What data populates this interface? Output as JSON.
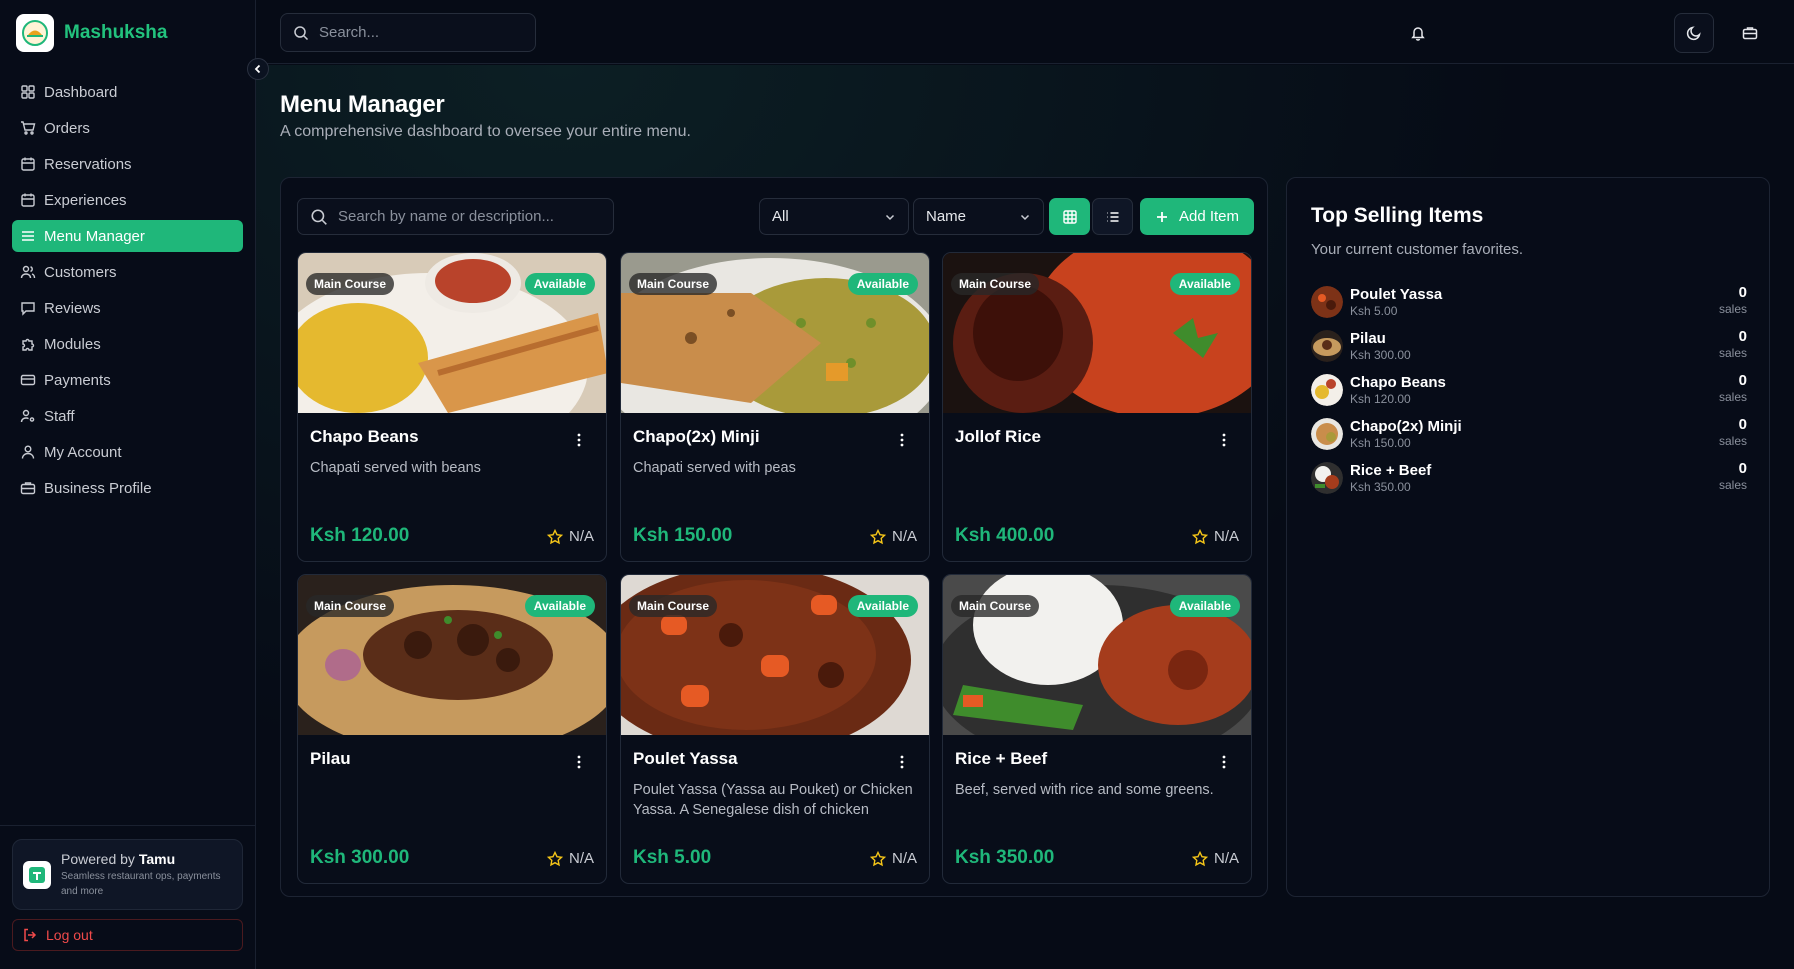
{
  "app": {
    "name": "Mashuksha"
  },
  "sidebar": {
    "items": [
      {
        "label": "Dashboard",
        "icon": "dashboard-icon"
      },
      {
        "label": "Orders",
        "icon": "cart-icon"
      },
      {
        "label": "Reservations",
        "icon": "calendar-icon"
      },
      {
        "label": "Experiences",
        "icon": "calendar-icon"
      },
      {
        "label": "Menu Manager",
        "icon": "menu-icon",
        "active": true
      },
      {
        "label": "Customers",
        "icon": "users-icon"
      },
      {
        "label": "Reviews",
        "icon": "message-icon"
      },
      {
        "label": "Modules",
        "icon": "puzzle-icon"
      },
      {
        "label": "Payments",
        "icon": "credit-card-icon"
      },
      {
        "label": "Staff",
        "icon": "user-cog-icon"
      },
      {
        "label": "My Account",
        "icon": "user-icon"
      },
      {
        "label": "Business Profile",
        "icon": "briefcase-icon"
      }
    ],
    "powered_prefix": "Powered by",
    "powered_brand": "Tamu",
    "powered_sub": "Seamless restaurant ops, payments and more",
    "logout": "Log out"
  },
  "topbar": {
    "search_placeholder": "Search..."
  },
  "page": {
    "title": "Menu Manager",
    "subtitle": "A comprehensive dashboard to oversee your entire menu."
  },
  "toolbar": {
    "search_placeholder": "Search by name or description...",
    "category_filter": "All",
    "sort": "Name",
    "add_label": "Add Item"
  },
  "menu_items": [
    {
      "name": "Chapo Beans",
      "category": "Main Course",
      "status": "Available",
      "description": "Chapati served with beans",
      "price": "Ksh 120.00",
      "rating": "N/A"
    },
    {
      "name": "Chapo(2x) Minji",
      "category": "Main Course",
      "status": "Available",
      "description": "Chapati served with peas",
      "price": "Ksh 150.00",
      "rating": "N/A"
    },
    {
      "name": "Jollof Rice",
      "category": "Main Course",
      "status": "Available",
      "description": "",
      "price": "Ksh 400.00",
      "rating": "N/A"
    },
    {
      "name": "Pilau",
      "category": "Main Course",
      "status": "Available",
      "description": "",
      "price": "Ksh 300.00",
      "rating": "N/A"
    },
    {
      "name": "Poulet Yassa",
      "category": "Main Course",
      "status": "Available",
      "description": "Poulet Yassa (Yassa au Pouket) or Chicken Yassa. A Senegalese dish of chicken",
      "price": "Ksh 5.00",
      "rating": "N/A"
    },
    {
      "name": "Rice + Beef",
      "category": "Main Course",
      "status": "Available",
      "description": "Beef, served with rice and some greens.",
      "price": "Ksh 350.00",
      "rating": "N/A"
    }
  ],
  "top_selling": {
    "title": "Top Selling Items",
    "subtitle": "Your current customer favorites.",
    "items": [
      {
        "name": "Poulet Yassa",
        "price": "Ksh 5.00",
        "count": "0",
        "unit": "sales"
      },
      {
        "name": "Pilau",
        "price": "Ksh 300.00",
        "count": "0",
        "unit": "sales"
      },
      {
        "name": "Chapo Beans",
        "price": "Ksh 120.00",
        "count": "0",
        "unit": "sales"
      },
      {
        "name": "Chapo(2x) Minji",
        "price": "Ksh 150.00",
        "count": "0",
        "unit": "sales"
      },
      {
        "name": "Rice + Beef",
        "price": "Ksh 350.00",
        "count": "0",
        "unit": "sales"
      }
    ]
  },
  "colors": {
    "accent": "#1fb77a",
    "brand": "#22c27d",
    "danger": "#f04a4a",
    "background": "#060b16"
  }
}
